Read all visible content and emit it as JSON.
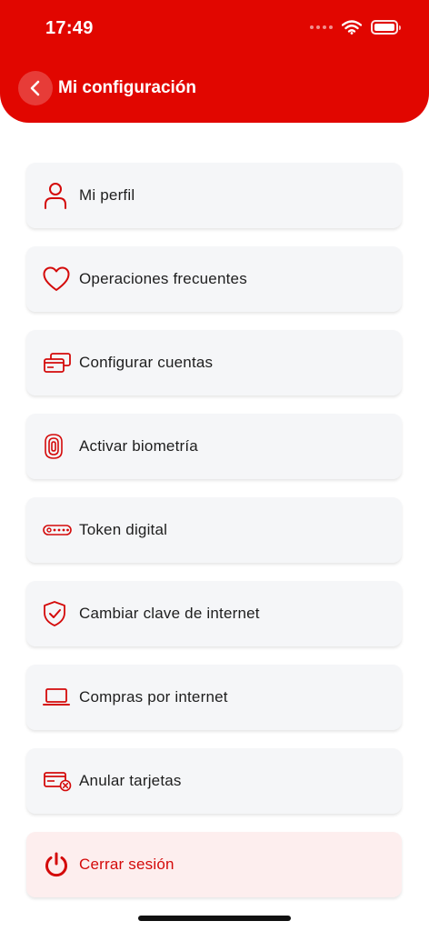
{
  "status_bar": {
    "time": "17:49"
  },
  "header": {
    "title": "Mi configuración",
    "back_icon": "chevron-left-icon"
  },
  "colors": {
    "primary": "#e10600",
    "icon_red": "#d40a0a",
    "card_bg": "#f5f6f8",
    "logout_bg": "#fdeeee"
  },
  "menu": {
    "items": [
      {
        "label": "Mi perfil",
        "icon": "user-icon"
      },
      {
        "label": "Operaciones frecuentes",
        "icon": "heart-icon"
      },
      {
        "label": "Configurar cuentas",
        "icon": "cards-icon"
      },
      {
        "label": "Activar biometría",
        "icon": "fingerprint-icon"
      },
      {
        "label": "Token digital",
        "icon": "token-icon"
      },
      {
        "label": "Cambiar clave de internet",
        "icon": "shield-check-icon"
      },
      {
        "label": "Compras por internet",
        "icon": "laptop-icon"
      },
      {
        "label": "Anular tarjetas",
        "icon": "card-cancel-icon"
      },
      {
        "label": "Cerrar sesión",
        "icon": "power-icon"
      }
    ]
  }
}
